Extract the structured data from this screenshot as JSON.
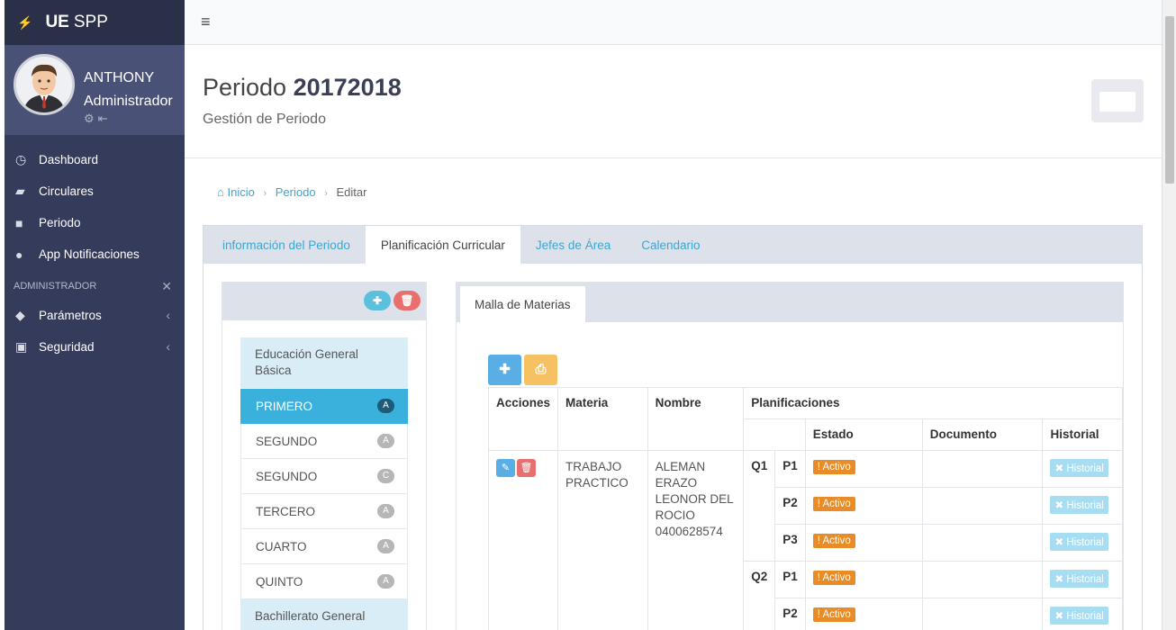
{
  "brand": {
    "bold": "UE",
    "rest": "SPP"
  },
  "user": {
    "name": "ANTHONY",
    "role": "Administrador"
  },
  "sidebar": {
    "items": [
      {
        "label": "Dashboard",
        "icon": "dashboard-icon"
      },
      {
        "label": "Circulares",
        "icon": "folder-open-icon"
      },
      {
        "label": "Periodo",
        "icon": "book-icon"
      },
      {
        "label": "App Notificaciones",
        "icon": "android-icon"
      }
    ],
    "admin_header": "ADMINISTRADOR",
    "admin_items": [
      {
        "label": "Parámetros",
        "icon": "tags-icon"
      },
      {
        "label": "Seguridad",
        "icon": "lock-icon"
      }
    ]
  },
  "header": {
    "title_prefix": "Periodo",
    "title_bold": "20172018",
    "subtitle": "Gestión de Periodo"
  },
  "breadcrumb": {
    "home": "Inicio",
    "periodo": "Periodo",
    "current": "Editar"
  },
  "tabs": [
    "información del Periodo",
    "Planificación Curricular",
    "Jefes de Área",
    "Calendario"
  ],
  "left_list": {
    "group1": "Educación General Básica",
    "items": [
      {
        "label": "PRIMERO",
        "badge": "A"
      },
      {
        "label": "SEGUNDO",
        "badge": "A"
      },
      {
        "label": "SEGUNDO",
        "badge": "C"
      },
      {
        "label": "TERCERO",
        "badge": "A"
      },
      {
        "label": "CUARTO",
        "badge": "A"
      },
      {
        "label": "QUINTO",
        "badge": "A"
      }
    ],
    "group2": "Bachillerato General"
  },
  "right_tab": "Malla de Materias",
  "table": {
    "headers": {
      "acciones": "Acciones",
      "materia": "Materia",
      "nombre": "Nombre",
      "planificaciones": "Planificaciones",
      "estado": "Estado",
      "documento": "Documento",
      "historial": "Historial"
    },
    "row": {
      "materia": "TRABAJO PRACTICO",
      "nombre": "ALEMAN ERAZO LEONOR DEL ROCIO 0400628574",
      "q1": "Q1",
      "q2": "Q2",
      "p1": "P1",
      "p2": "P2",
      "p3": "P3",
      "estado": "Activo",
      "historial": "Historial"
    }
  },
  "colors": {
    "sidebar": "#353b5a",
    "accent": "#39b1dc",
    "warning": "#e98b26",
    "danger": "#e96f6f"
  }
}
